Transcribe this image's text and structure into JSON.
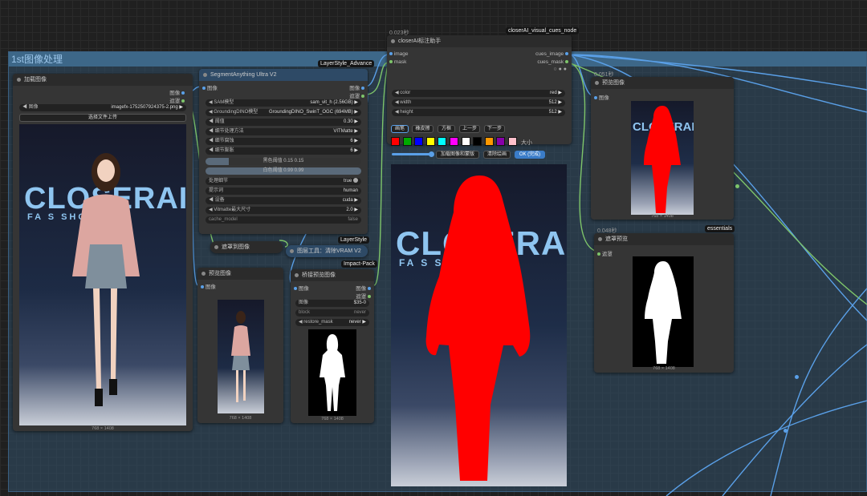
{
  "group": {
    "title": "1st图像处理"
  },
  "nodes": {
    "load_image": {
      "title": "加载图像",
      "out_image": "图像",
      "out_mask": "遮罩",
      "image_label": "图像",
      "image_value": "imagefx-1752507924375-2.png",
      "upload": "选择文件上传",
      "dims": "768 × 1408",
      "poster_text": "CLOSERAI",
      "poster_sub": "FA S  SHOW"
    },
    "segment": {
      "title": "SegmentAnything Ultra V2",
      "badge": "LayerStyle_Advance",
      "in_image": "图像",
      "out_image": "图像",
      "out_mask": "遮罩",
      "widgets": [
        {
          "label": "SAM模型",
          "value": "sam_vit_h (2.56GB)"
        },
        {
          "label": "GroundingDINO模型",
          "value": "GroundingDINO_SwinT_OGC (694MB)"
        },
        {
          "label": "阈值",
          "value": "0.30"
        },
        {
          "label": "细节处理方法",
          "value": "VITMatte"
        },
        {
          "label": "细节腐蚀",
          "value": "6"
        },
        {
          "label": "细节膨胀",
          "value": "6"
        }
      ],
      "black_point": "黑色阈值 0.15  0.15",
      "white_point": "白色阈值 0.99  0.99",
      "widgets2": [
        {
          "label": "处理细节",
          "value": "true"
        },
        {
          "label": "提示词",
          "value": "human"
        },
        {
          "label": "设备",
          "value": "cuda"
        },
        {
          "label": "Vitmatte最大尺寸",
          "value": "2.0"
        },
        {
          "label": "cache_model",
          "value": "false"
        }
      ]
    },
    "mask_to_image": {
      "title": "遮罩到图像"
    },
    "purge_vram": {
      "title": "图层工具：清除VRAM V2",
      "badge": "LayerStyle"
    },
    "preview1": {
      "title": "预览图像",
      "in_image": "图像",
      "dims": "768 × 1408"
    },
    "bridge": {
      "title": "桥接预览图像",
      "badge": "Impact-Pack",
      "in_image": "图像",
      "out_image": "图像",
      "out_mask": "遮罩",
      "w_image": "图像",
      "w_image_v": "$35-0",
      "w_block": "block",
      "w_block_v": "never",
      "w_restore": "restore_mask",
      "w_restore_v": "never",
      "dims": "768 × 1408"
    },
    "closer": {
      "time": "0.023秒",
      "badge": "closerAI_visual_cues_node",
      "title": "closerAI标注助手",
      "in_image": "image",
      "in_mask": "mask",
      "out_image": "cues_image",
      "out_mask": "cues_mask",
      "widgets": [
        {
          "label": "color",
          "value": "red"
        },
        {
          "label": "width",
          "value": "512"
        },
        {
          "label": "height",
          "value": "512"
        }
      ],
      "tools": [
        "画笔",
        "橡皮擦",
        "方框",
        "上一步",
        "下一步"
      ],
      "size_label": "大小",
      "load_btn": "加载图像和蒙版",
      "clear_btn": "清除绘画",
      "ok_btn": "OK (完成)",
      "swatches": [
        "#ff0000",
        "#00aa00",
        "#0000ff",
        "#ffff00",
        "#00ffff",
        "#ff00ff",
        "#ffffff",
        "#000000",
        "#ff9900",
        "#8800aa",
        "#ffc0cb"
      ]
    },
    "preview2": {
      "time": "0.051秒",
      "title": "预览图像",
      "in_image": "图像",
      "dims": "768 × 1408"
    },
    "mask_preview": {
      "time": "0.048秒",
      "badge": "essentials",
      "title": "遮罩预览",
      "in_mask": "遮罩",
      "dims": "768 × 1408"
    }
  },
  "colors": {
    "image_wire": "#5aa0e8",
    "mask_wire": "#7ec56a",
    "paint": "#ff0000"
  }
}
